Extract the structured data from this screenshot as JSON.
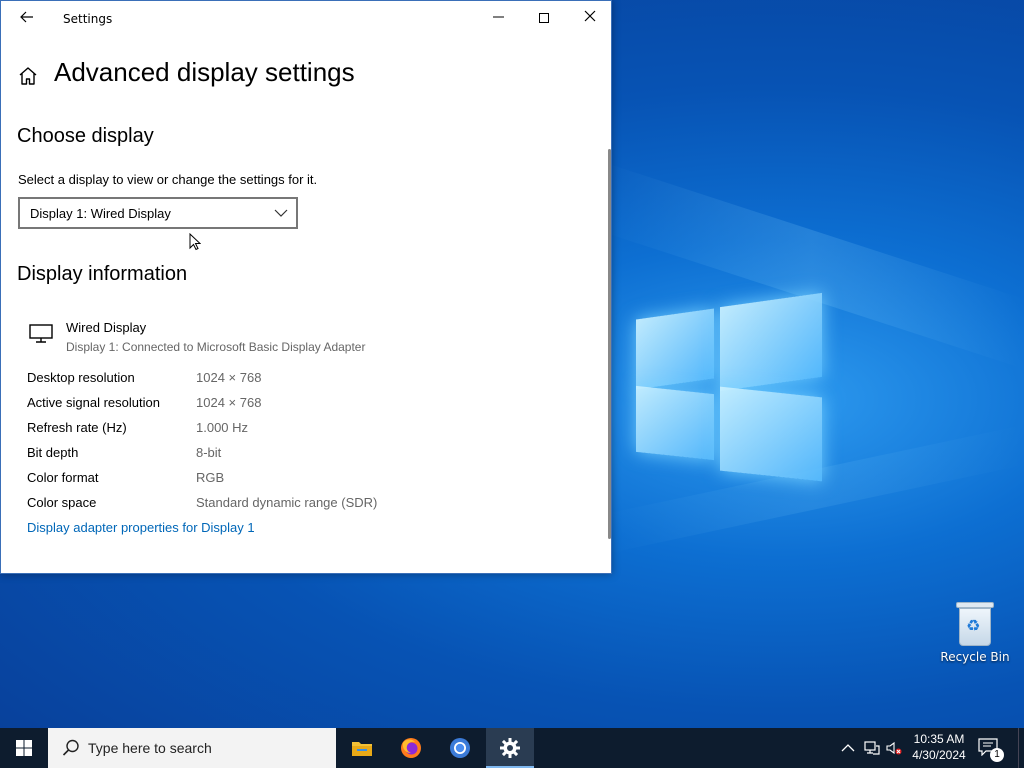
{
  "window": {
    "title": "Settings",
    "minimize": "—",
    "close": "✕"
  },
  "page": {
    "title": "Advanced display settings"
  },
  "choose_display": {
    "heading": "Choose display",
    "description": "Select a display to view or change the settings for it.",
    "selected": "Display 1: Wired Display"
  },
  "display_info": {
    "heading": "Display information",
    "name": "Wired Display",
    "subtitle": "Display 1: Connected to Microsoft Basic Display Adapter",
    "rows": [
      {
        "label": "Desktop resolution",
        "value": "1024 × 768"
      },
      {
        "label": "Active signal resolution",
        "value": "1024 × 768"
      },
      {
        "label": "Refresh rate (Hz)",
        "value": "1.000 Hz"
      },
      {
        "label": "Bit depth",
        "value": "8-bit"
      },
      {
        "label": "Color format",
        "value": "RGB"
      },
      {
        "label": "Color space",
        "value": "Standard dynamic range (SDR)"
      }
    ],
    "link": "Display adapter properties for Display 1"
  },
  "desktop": {
    "recycle_bin": "Recycle Bin"
  },
  "taskbar": {
    "search_placeholder": "Type here to search",
    "apps": [
      "file-explorer-icon",
      "firefox-icon",
      "chrome-icon",
      "settings-icon"
    ],
    "time": "10:35 AM",
    "date": "4/30/2024",
    "notification_count": "1"
  },
  "colors": {
    "accent_link": "#0067b8",
    "taskbar": "#0d1c2e",
    "desktop": "#0a5ec4"
  }
}
